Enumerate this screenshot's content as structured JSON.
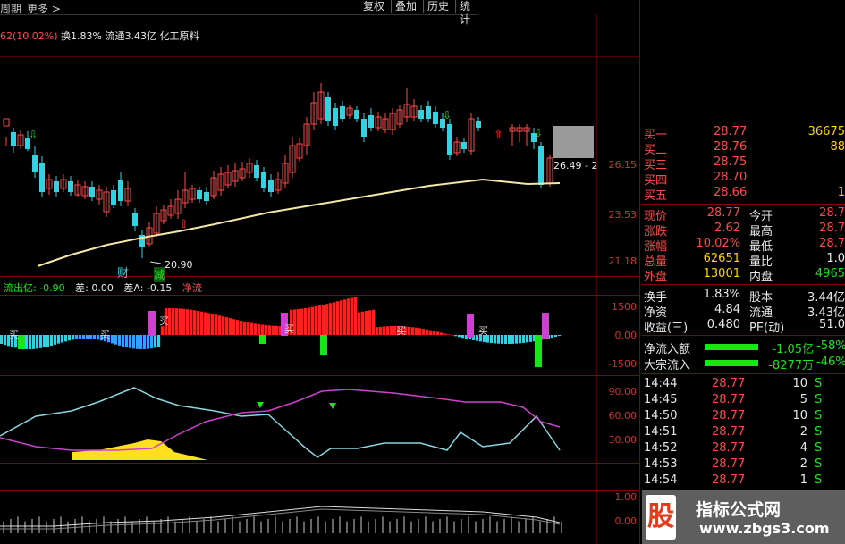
{
  "toolbar": {
    "period_label": "周期",
    "more_label": "更多 >",
    "buttons": [
      "复权",
      "叠加",
      "历史",
      "统计"
    ]
  },
  "stock_info": {
    "change": "62(10.02%)",
    "turnover": "换1.83%",
    "float_cap": "流通3.43亿",
    "sector": "化工原料"
  },
  "price_axis": [
    "26.15",
    "23.53",
    "21.18"
  ],
  "chart_labels": {
    "low_marker": "20.90",
    "high_marker": "26.49 - 2",
    "cai": "财",
    "jian": "减",
    "buy": "买"
  },
  "flow_bar": {
    "outflow": "流出亿: -0.90",
    "diff": "差: 0.00",
    "diff_a": "差A: -0.15",
    "net": "净流"
  },
  "indicator1_axis": [
    "1500",
    "0.00",
    "-1500"
  ],
  "indicator2_axis": [
    "90.00",
    "60.00",
    "30.00"
  ],
  "indicator3_axis": [
    "1.00",
    "0.00"
  ],
  "right_panel": {
    "bids": [
      {
        "label": "买一",
        "price": "28.77",
        "vol": "36675"
      },
      {
        "label": "买二",
        "price": "28.76",
        "vol": "88"
      },
      {
        "label": "买三",
        "price": "28.75",
        "vol": ""
      },
      {
        "label": "买四",
        "price": "28.70",
        "vol": ""
      },
      {
        "label": "买五",
        "price": "28.66",
        "vol": "1"
      }
    ],
    "quote": [
      {
        "l1": "现价",
        "v1": "28.77",
        "l2": "今开",
        "v2": "28.7"
      },
      {
        "l1": "涨跌",
        "v1": "2.62",
        "l2": "最高",
        "v2": "28.7"
      },
      {
        "l1": "涨幅",
        "v1": "10.02%",
        "l2": "最低",
        "v2": "28.7"
      },
      {
        "l1": "总量",
        "v1": "62651",
        "l2": "量比",
        "v2": "1.0"
      },
      {
        "l1": "外盘",
        "v1": "13001",
        "l2": "内盘",
        "v2": "4965"
      }
    ],
    "stats": [
      {
        "l1": "换手",
        "v1": "1.83%",
        "l2": "股本",
        "v2": "3.44亿"
      },
      {
        "l1": "净资",
        "v1": "4.84",
        "l2": "流通",
        "v2": "3.43亿"
      },
      {
        "l1": "收益(三)",
        "v1": "0.480",
        "l2": "PE(动)",
        "v2": "51.0"
      }
    ],
    "flows": [
      {
        "label": "净流入额",
        "value": "-1.05亿",
        "pct": "-58%"
      },
      {
        "label": "大宗流入",
        "value": "-8277万",
        "pct": "-46%"
      }
    ],
    "ticks": [
      {
        "time": "14:44",
        "price": "28.77",
        "vol": "10",
        "side": "S"
      },
      {
        "time": "14:45",
        "price": "28.77",
        "vol": "5",
        "side": "S"
      },
      {
        "time": "14:50",
        "price": "28.77",
        "vol": "10",
        "side": "S"
      },
      {
        "time": "14:51",
        "price": "28.77",
        "vol": "2",
        "side": "S"
      },
      {
        "time": "14:52",
        "price": "28.77",
        "vol": "4",
        "side": "S"
      },
      {
        "time": "14:53",
        "price": "28.77",
        "vol": "2",
        "side": "S"
      },
      {
        "time": "14:54",
        "price": "28.77",
        "vol": "1",
        "side": "S"
      }
    ]
  },
  "watermark": {
    "logo_char": "股",
    "title": "指标公式网",
    "url": "www.zbgs3.com"
  },
  "colors": {
    "up": "#ff4a4a",
    "down": "#35d1e0",
    "ma": "#f3e7a8",
    "grid": "#8a0000"
  }
}
